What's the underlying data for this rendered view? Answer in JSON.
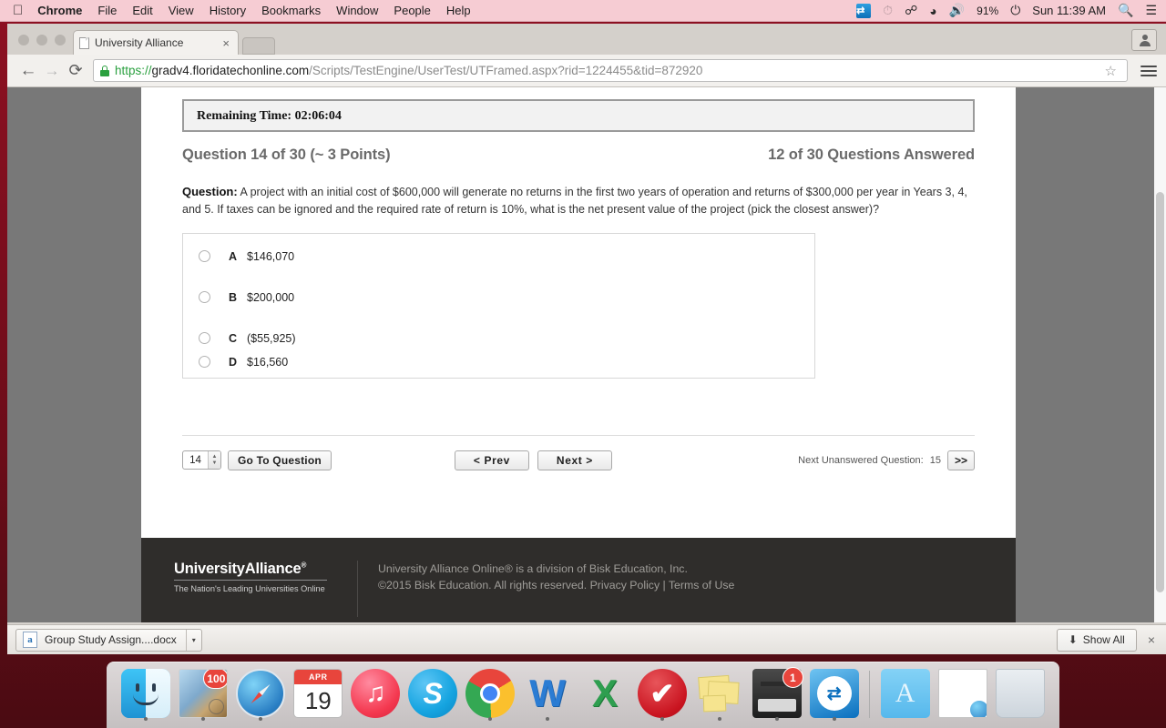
{
  "menubar": {
    "apple_icon": "apple-icon",
    "items": [
      {
        "label": "Chrome",
        "bold": true
      },
      {
        "label": "File",
        "bold": false
      },
      {
        "label": "Edit",
        "bold": false
      },
      {
        "label": "View",
        "bold": false
      },
      {
        "label": "History",
        "bold": false
      },
      {
        "label": "Bookmarks",
        "bold": false
      },
      {
        "label": "Window",
        "bold": false
      },
      {
        "label": "People",
        "bold": false
      },
      {
        "label": "Help",
        "bold": false
      }
    ],
    "status": {
      "teamviewer_icon": "teamviewer-icon",
      "timemachine_icon": "time-machine-icon",
      "bluetooth_icon": "bluetooth-icon",
      "wifi_icon": "wifi-icon",
      "volume_icon": "volume-icon",
      "battery_percent": "91%",
      "battery_icon": "battery-charging-icon",
      "clock": "Sun 11:39 AM",
      "spotlight_icon": "search-icon",
      "notification_icon": "notification-center-icon"
    },
    "background_color": "#f6ccd3"
  },
  "browser": {
    "tab": {
      "title": "University Alliance",
      "close_label": "×",
      "favicon": "page-icon"
    },
    "new_tab_label": "",
    "profile_icon": "person-icon",
    "toolbar": {
      "back_icon": "arrow-left-icon",
      "forward_icon": "arrow-right-icon",
      "reload_icon": "reload-icon",
      "bookmark_icon": "star-icon",
      "menu_icon": "hamburger-menu-icon",
      "lock_icon": "lock-icon",
      "url_scheme": "https://",
      "url_host": "gradv4.floridatechonline.com",
      "url_path": "/Scripts/TestEngine/UserTest/UTFramed.aspx?rid=1224455&tid=872920"
    }
  },
  "exam": {
    "timer": {
      "label": "Remaining Time: 02:06:04"
    },
    "header": {
      "question_counter": "Question 14 of 30 (~ 3 Points)",
      "answered_counter": "12 of 30 Questions Answered"
    },
    "question": {
      "prefix": "Question:",
      "body": "A project with an initial cost of $600,000 will generate no returns in the first two years of operation and returns of $300,000 per year in Years 3, 4, and 5. If taxes can be ignored and the required rate of return is 10%, what is the net present value of the project (pick the closest answer)?"
    },
    "options": [
      {
        "letter": "A",
        "text": "$146,070",
        "selected": false
      },
      {
        "letter": "B",
        "text": "$200,000",
        "selected": false
      },
      {
        "letter": "C",
        "text": "($55,925)",
        "selected": false
      },
      {
        "letter": "D",
        "text": "$16,560",
        "selected": false
      }
    ],
    "nav": {
      "question_number_value": "14",
      "go_to_question_label": "Go To Question",
      "prev_label": "<  Prev",
      "next_label": "Next  >",
      "next_unanswered_label": "Next Unanswered Question:",
      "next_unanswered_value": "15",
      "next_unanswered_button": ">>"
    }
  },
  "footer": {
    "logo_first": "University",
    "logo_second": "Alliance",
    "logo_reg": "®",
    "tagline": "The Nation's Leading Universities Online",
    "line1": "University Alliance Online® is a division of Bisk Education, Inc.",
    "line2": "©2015 Bisk Education. All rights reserved. Privacy Policy | Terms of Use",
    "background_color": "#2f2d2b"
  },
  "download_shelf": {
    "file_name": "Group Study Assign....docx",
    "file_icon": "word-document-icon",
    "caret_label": "▾",
    "show_all_label": "Show All",
    "show_all_icon": "download-arrow-icon",
    "close_label": "×"
  },
  "dock": {
    "items": [
      {
        "name": "finder",
        "label": "Finder",
        "running": true
      },
      {
        "name": "mail",
        "label": "Mail",
        "badge": "100",
        "running": true
      },
      {
        "name": "safari",
        "label": "Safari",
        "running": true
      },
      {
        "name": "calendar",
        "label": "Calendar",
        "month": "APR",
        "day": "19",
        "running": false
      },
      {
        "name": "itunes",
        "label": "iTunes",
        "glyph": "♫",
        "running": false
      },
      {
        "name": "skype",
        "label": "Skype",
        "glyph": "S",
        "running": false
      },
      {
        "name": "chrome",
        "label": "Google Chrome",
        "running": true
      },
      {
        "name": "word",
        "label": "Microsoft Word",
        "glyph": "W",
        "running": true
      },
      {
        "name": "excel",
        "label": "Microsoft Excel",
        "glyph": "X",
        "running": false
      },
      {
        "name": "checkmark-app",
        "label": "Checkmark",
        "glyph": "✔",
        "running": true
      },
      {
        "name": "stickies",
        "label": "Stickies",
        "running": true
      },
      {
        "name": "printer",
        "label": "Printer",
        "badge": "1",
        "running": true
      },
      {
        "name": "teamviewer",
        "label": "TeamViewer",
        "glyph": "⇄",
        "running": true
      }
    ],
    "stack_items": [
      {
        "name": "applications-folder",
        "label": "Applications"
      },
      {
        "name": "documents-stack",
        "label": "Documents"
      },
      {
        "name": "trash",
        "label": "Trash"
      }
    ]
  }
}
